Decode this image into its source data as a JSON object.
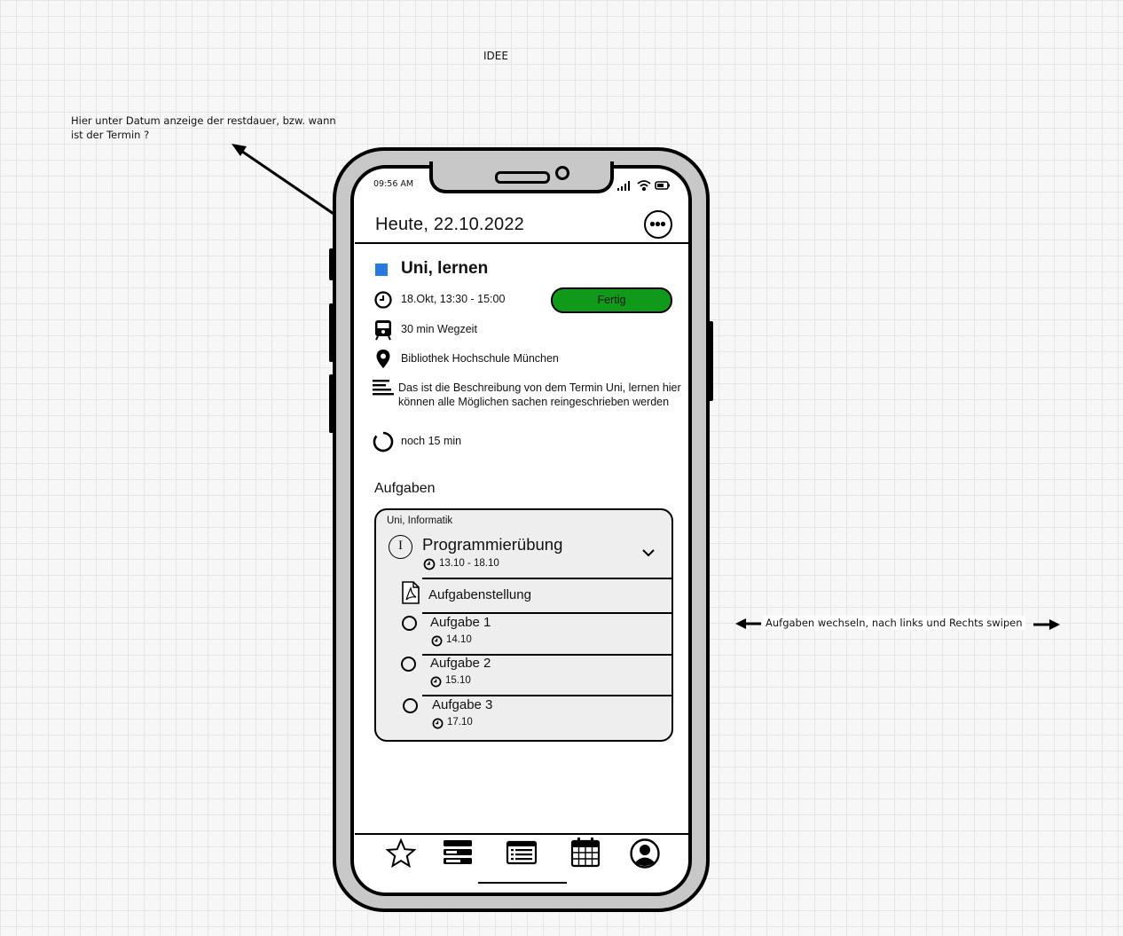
{
  "canvas": {
    "page_label": "IDEE",
    "note_top": "Hier unter Datum anzeige der restdauer, bzw. wann ist der Termin ?",
    "note_right": "Aufgaben wechseln, nach links und Rechts swipen"
  },
  "status_bar": {
    "time": "09:56 AM",
    "icons": [
      "signal-icon",
      "wifi-icon",
      "battery-icon"
    ]
  },
  "header": {
    "title": "Heute, 22.10.2022",
    "menu_icon": "more-dots-icon"
  },
  "event": {
    "color": "#2a78e4",
    "title": "Uni, lernen",
    "time": "18.Okt,  13:30 - 15:00",
    "done_label": "Fertig",
    "done_color": "#0f9a1a",
    "travel": "30 min Wegzeit",
    "location": "Bibliothek Hochschule München",
    "description": "Das ist die Beschreibung von dem Termin Uni, lernen hier können alle Möglichen sachen reingeschrieben werden",
    "remaining": "noch 15 min"
  },
  "tasks": {
    "section_title": "Aufgaben",
    "card": {
      "category": "Uni, Informatik",
      "badge": "I",
      "title": "Programmierübung",
      "date_range": "13.10 - 18.10",
      "attachment": "Aufgabenstellung",
      "items": [
        {
          "title": "Aufgabe 1",
          "date": "14.10"
        },
        {
          "title": "Aufgabe 2",
          "date": "15.10"
        },
        {
          "title": "Aufgabe 3",
          "date": "17.10"
        }
      ]
    }
  },
  "bottom_nav": [
    "star-icon",
    "stack-icon",
    "list-icon",
    "calendar-icon",
    "profile-icon"
  ]
}
